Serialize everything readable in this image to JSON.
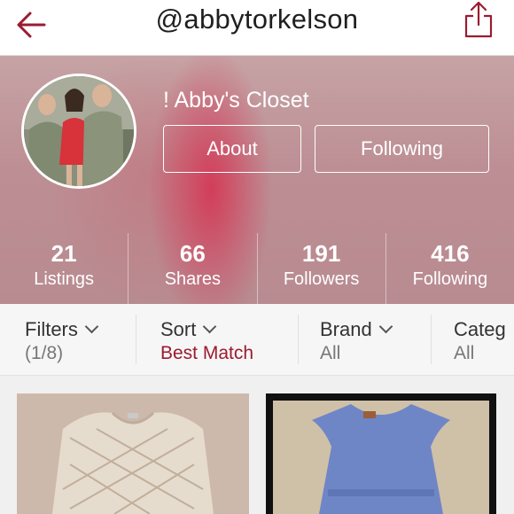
{
  "header": {
    "title": "@abbytorkelson",
    "accent_color": "#9b1b30",
    "back_icon": "back-arrow-icon",
    "share_icon": "share-icon"
  },
  "profile": {
    "shop_name": "! Abby's Closet",
    "about_label": "About",
    "following_button_label": "Following"
  },
  "stats": [
    {
      "value": "21",
      "label": "Listings"
    },
    {
      "value": "66",
      "label": "Shares"
    },
    {
      "value": "191",
      "label": "Followers"
    },
    {
      "value": "416",
      "label": "Following"
    }
  ],
  "filters": [
    {
      "label": "Filters",
      "value": "(1/8)"
    },
    {
      "label": "Sort",
      "value": "Best Match",
      "value_color": "#9b1b30"
    },
    {
      "label": "Brand",
      "value": "All"
    },
    {
      "label": "Categ",
      "value": "All"
    }
  ]
}
